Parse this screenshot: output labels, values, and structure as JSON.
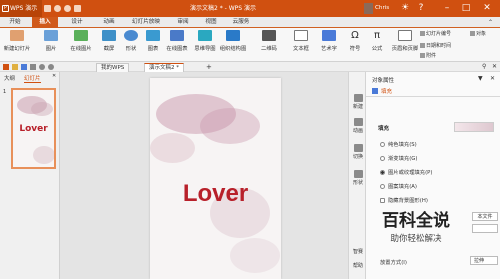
{
  "app": {
    "name": "WPS 演示",
    "window_title": "演示文稿2 * - WPS 演示",
    "user": "Chris"
  },
  "ribbon_tabs": [
    "开始",
    "插入",
    "设计",
    "动画",
    "幻灯片放映",
    "审阅",
    "视图",
    "云服务"
  ],
  "active_tab": "插入",
  "ribbon": {
    "big": [
      "新建幻灯片",
      "图片",
      "在线图片",
      "截屏",
      "形状",
      "图表",
      "在线图表",
      "思维导图",
      "组织结构图",
      "二维码",
      "文本框",
      "艺术字",
      "符号",
      "公式",
      "页眉和页脚"
    ],
    "small": [
      "幻灯片编号",
      "日期和时间",
      "附件",
      "对象"
    ]
  },
  "quick_access": {
    "doc_tabs": [
      "我的WPS",
      "演示文稿2 *"
    ],
    "plus": "+"
  },
  "left_panel": {
    "tabs": [
      "大纲",
      "幻灯片"
    ],
    "slide_number": "1",
    "thumb_text": "Lover"
  },
  "slide": {
    "text": "Lover"
  },
  "side_icons": [
    "新建",
    "动画",
    "切换",
    "形状"
  ],
  "side_icons_bottom": [
    "智赛",
    "帮助"
  ],
  "props": {
    "header": "对象属性",
    "tab_fill": "填充",
    "section": "填充",
    "options": [
      "纯色填充(S)",
      "渐变填充(G)",
      "图片或纹理填充(P)",
      "图案填充(A)",
      "隐藏背景图形(H)"
    ],
    "selected_option": 2,
    "btn_file": "本文件",
    "label_offset": "放置方式(I)",
    "stretch": "拉伸"
  },
  "watermark": {
    "line1": "百科全说",
    "line2": "助你轻松解决"
  },
  "colors": {
    "accent": "#d05010",
    "slide_text": "#b8202a"
  }
}
